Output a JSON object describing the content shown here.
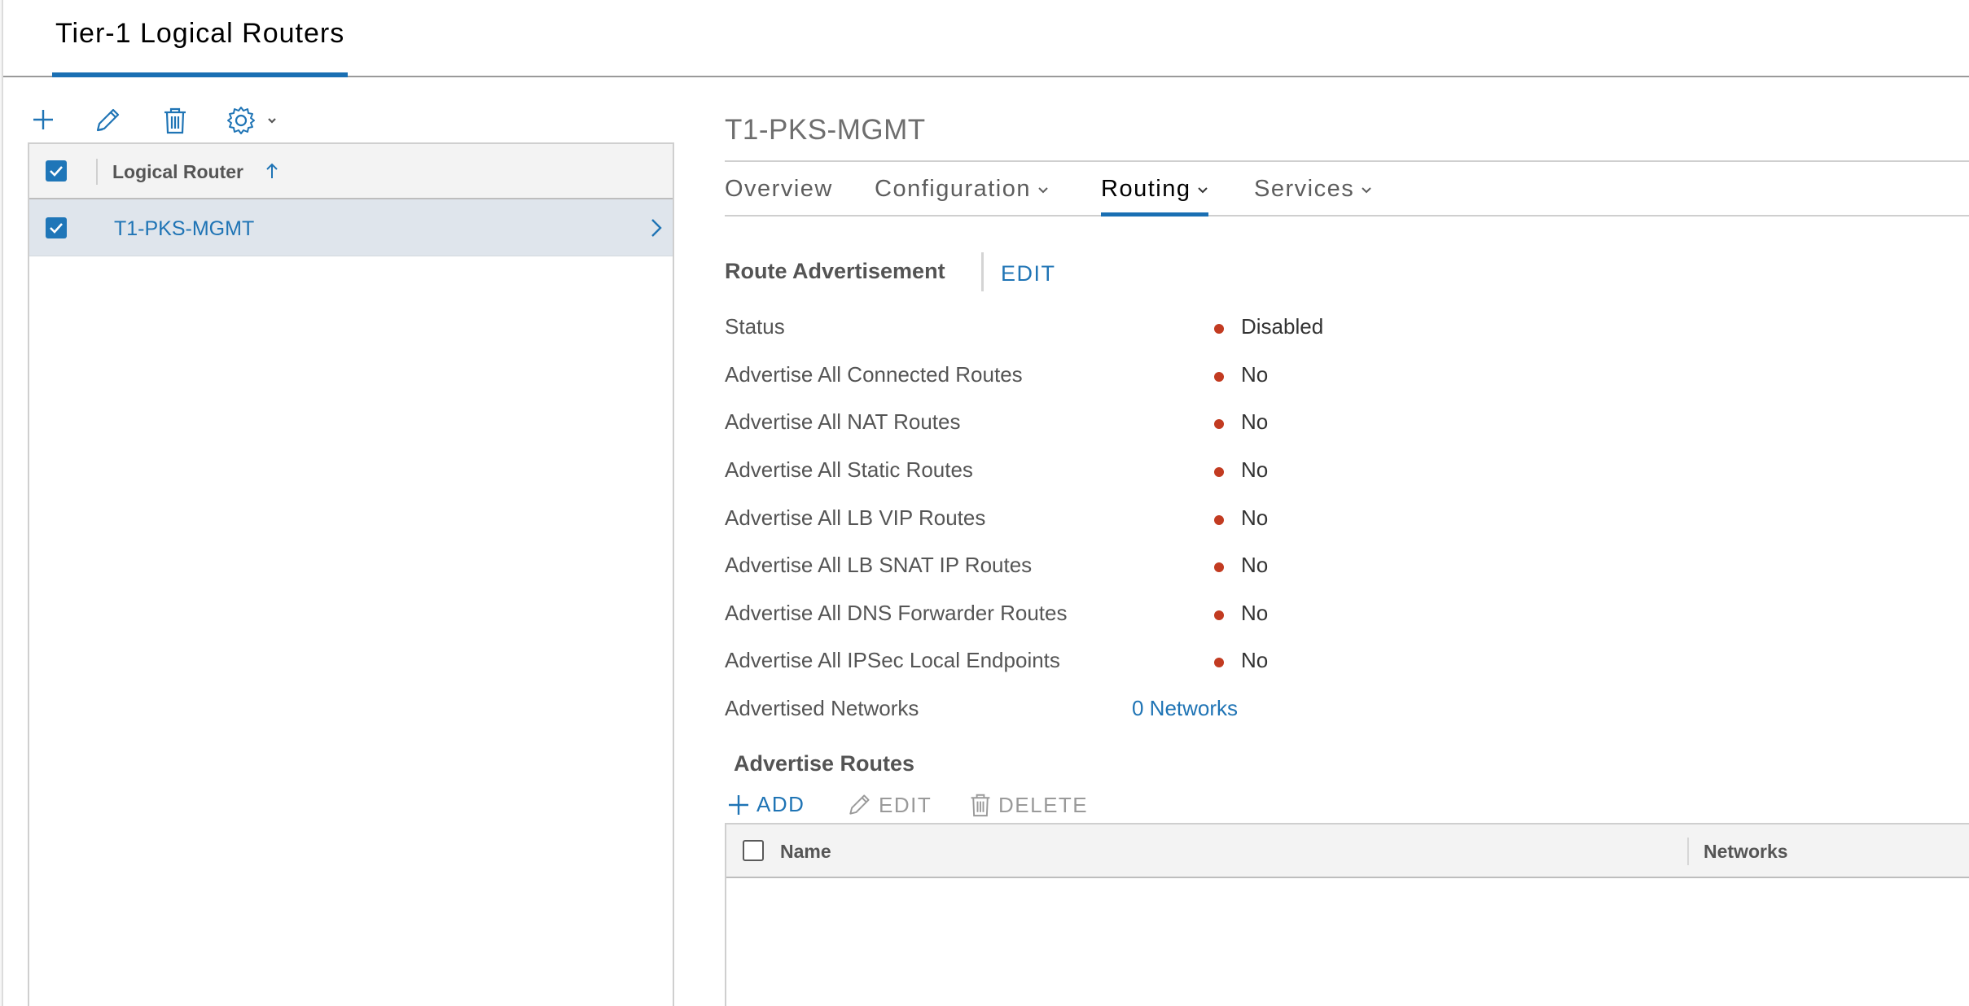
{
  "page": {
    "tab_label": "Tier-1 Logical Routers"
  },
  "toolbar": {
    "add_icon": "plus-icon",
    "edit_icon": "pencil-icon",
    "delete_icon": "trash-icon",
    "settings_icon": "gear-icon"
  },
  "grid": {
    "column_header": "Logical Router",
    "sort": "ascending",
    "rows": [
      {
        "name": "T1-PKS-MGMT",
        "selected": true
      }
    ]
  },
  "detail": {
    "title": "T1-PKS-MGMT",
    "tabs": [
      {
        "label": "Overview",
        "has_dropdown": false,
        "active": false
      },
      {
        "label": "Configuration",
        "has_dropdown": true,
        "active": false
      },
      {
        "label": "Routing",
        "has_dropdown": true,
        "active": true
      },
      {
        "label": "Services",
        "has_dropdown": true,
        "active": false
      }
    ],
    "route_advertisement": {
      "heading": "Route Advertisement",
      "edit_label": "EDIT",
      "properties": [
        {
          "label": "Status",
          "value": "Disabled"
        },
        {
          "label": "Advertise All Connected Routes",
          "value": "No"
        },
        {
          "label": "Advertise All NAT Routes",
          "value": "No"
        },
        {
          "label": "Advertise All Static Routes",
          "value": "No"
        },
        {
          "label": "Advertise All LB VIP Routes",
          "value": "No"
        },
        {
          "label": "Advertise All LB SNAT IP Routes",
          "value": "No"
        },
        {
          "label": "Advertise All DNS Forwarder Routes",
          "value": "No"
        },
        {
          "label": "Advertise All IPSec Local Endpoints",
          "value": "No"
        }
      ],
      "advertised_networks": {
        "label": "Advertised Networks",
        "value": "0 Networks"
      }
    },
    "advertise_routes": {
      "heading": "Advertise Routes",
      "actions": {
        "add": "ADD",
        "edit": "EDIT",
        "delete": "DELETE"
      },
      "columns": {
        "name": "Name",
        "networks": "Networks"
      }
    }
  },
  "colors": {
    "accent": "#1a6fb3",
    "link": "#1f74b5",
    "status_red": "#c23b21",
    "selected_row": "#dfe5ec"
  }
}
